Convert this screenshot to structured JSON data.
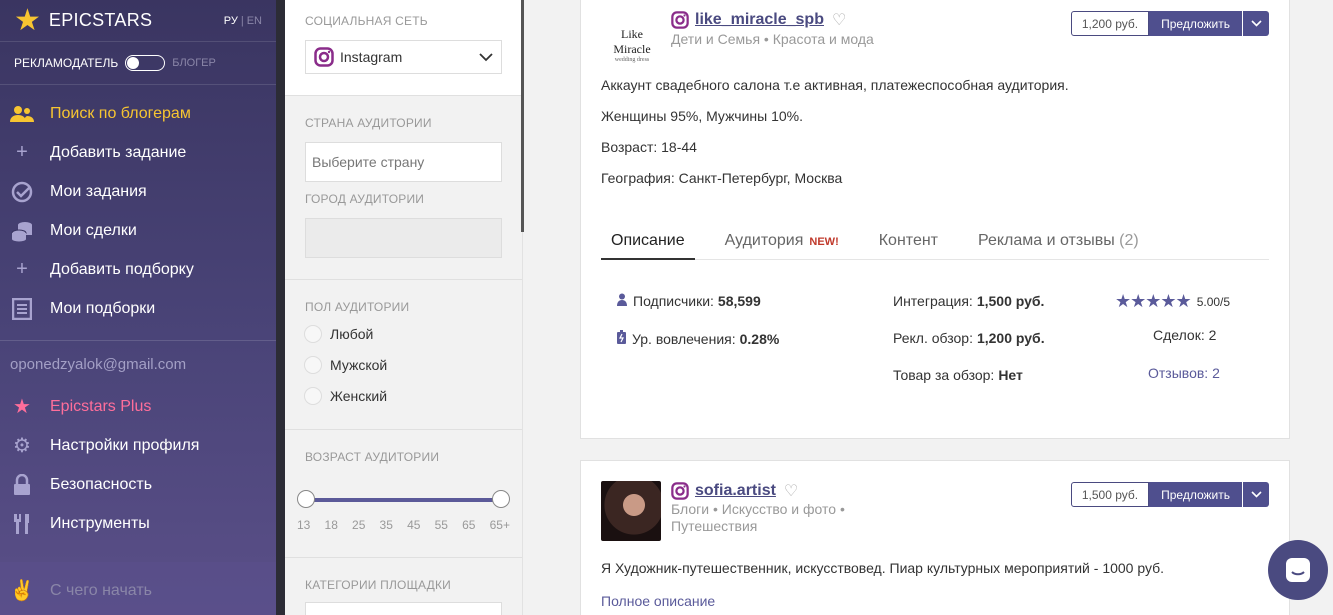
{
  "brand": {
    "name": "EPICSTARS",
    "lang_ru": "РУ",
    "lang_en": "EN"
  },
  "mode": {
    "advertiser": "РЕКЛАМОДАТЕЛЬ",
    "blogger": "БЛОГЕР"
  },
  "nav": [
    {
      "label": "Поиск по блогерам"
    },
    {
      "label": "Добавить задание"
    },
    {
      "label": "Мои задания"
    },
    {
      "label": "Мои сделки"
    },
    {
      "label": "Добавить подборку"
    },
    {
      "label": "Мои подборки"
    }
  ],
  "account": {
    "email": "oponedzyalok@gmail.com"
  },
  "nav2": [
    {
      "label": "Epicstars Plus"
    },
    {
      "label": "Настройки профиля"
    },
    {
      "label": "Безопасность"
    },
    {
      "label": "Инструменты"
    },
    {
      "label": "С чего начать"
    }
  ],
  "filters": {
    "network_label": "СОЦИАЛЬНАЯ СЕТЬ",
    "network_value": "Instagram",
    "country_label": "СТРАНА АУДИТОРИИ",
    "country_placeholder": "Выберите страну",
    "city_label": "ГОРОД АУДИТОРИИ",
    "gender_label": "ПОЛ АУДИТОРИИ",
    "gender_options": [
      "Любой",
      "Мужской",
      "Женский"
    ],
    "age_label": "ВОЗРАСТ АУДИТОРИИ",
    "age_ticks": [
      "13",
      "18",
      "25",
      "35",
      "45",
      "55",
      "65",
      "65+"
    ],
    "categories_label": "КАТЕГОРИИ ПЛОЩАДКИ"
  },
  "cards": [
    {
      "logo_big": "Like Miracle",
      "logo_small": "wedding dress",
      "username": "like_miracle_spb",
      "categories": "Дети и Семья • Красота и мода",
      "price": "1,200 руб.",
      "offer_label": "Предложить",
      "description": [
        "Аккаунт свадебного салона т.е активная, платежеспособная аудитория.",
        "Женщины 95%, Мужчины 10%.",
        "Возраст: 18-44",
        "География: Санкт-Петербург, Москва"
      ],
      "tabs": {
        "description": "Описание",
        "audience": "Аудитория",
        "new": "NEW!",
        "content": "Контент",
        "ads": "Реклама и отзывы",
        "ads_count": "(2)"
      },
      "stats": {
        "subs_label": "Подписчики:",
        "subs_value": "58,599",
        "eng_label": "Ур. вовлечения:",
        "eng_value": "0.28%",
        "int_label": "Интеграция:",
        "int_value": "1,500 руб.",
        "review_label": "Рекл. обзор:",
        "review_value": "1,200 руб.",
        "goods_label": "Товар за обзор:",
        "goods_value": "Нет",
        "rating": 5,
        "score": "5.00/5",
        "deals": "Сделок: 2",
        "reviews": "Отзывов: 2"
      }
    },
    {
      "username": "sofia.artist",
      "categories": "Блоги • Искусство и фото • Путешествия",
      "price": "1,500 руб.",
      "offer_label": "Предложить",
      "description": "Я Художник-путешественник, искусствовед. Пиар культурных мероприятий - 1000 руб.",
      "full_description_link": "Полное описание"
    }
  ],
  "colors": {
    "accent": "#4f4f8e",
    "gold": "#f7c531",
    "pink": "#ff6e9b"
  }
}
